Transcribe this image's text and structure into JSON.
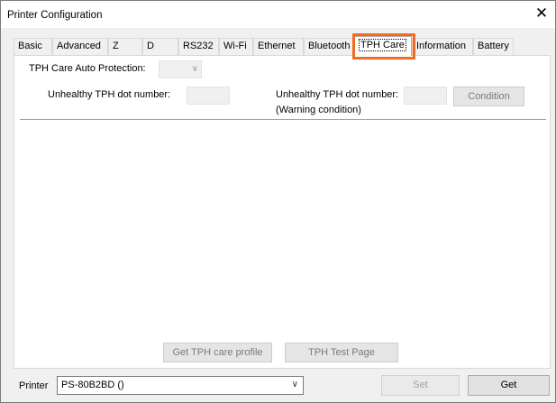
{
  "window": {
    "title": "Printer Configuration",
    "close_glyph": "✕"
  },
  "tabs": [
    {
      "label": "Basic",
      "active": false
    },
    {
      "label": "Advanced",
      "active": false
    },
    {
      "label": "Z",
      "active": false
    },
    {
      "label": "D",
      "active": false
    },
    {
      "label": "RS232",
      "active": false
    },
    {
      "label": "Wi-Fi",
      "active": false
    },
    {
      "label": "Ethernet",
      "active": false
    },
    {
      "label": "Bluetooth",
      "active": false
    },
    {
      "label": "TPH Care",
      "active": true
    },
    {
      "label": "Information",
      "active": false
    },
    {
      "label": "Battery",
      "active": false
    }
  ],
  "highlight_color": "#f26b21",
  "tph_care": {
    "auto_protection_label": "TPH Care Auto Protection:",
    "auto_protection_value": "",
    "unhealthy_dot_label": "Unhealthy TPH dot number:",
    "unhealthy_dot_value": "",
    "unhealthy_dot_warning_label": "Unhealthy TPH dot number:",
    "warning_condition_label": "(Warning condition)",
    "unhealthy_dot_warning_value": "",
    "condition_button": "Condition",
    "get_profile_button": "Get TPH care profile",
    "test_page_button": "TPH Test Page"
  },
  "footer": {
    "printer_label": "Printer",
    "printer_value": "PS-80B2BD ()",
    "set_button": "Set",
    "get_button": "Get"
  }
}
